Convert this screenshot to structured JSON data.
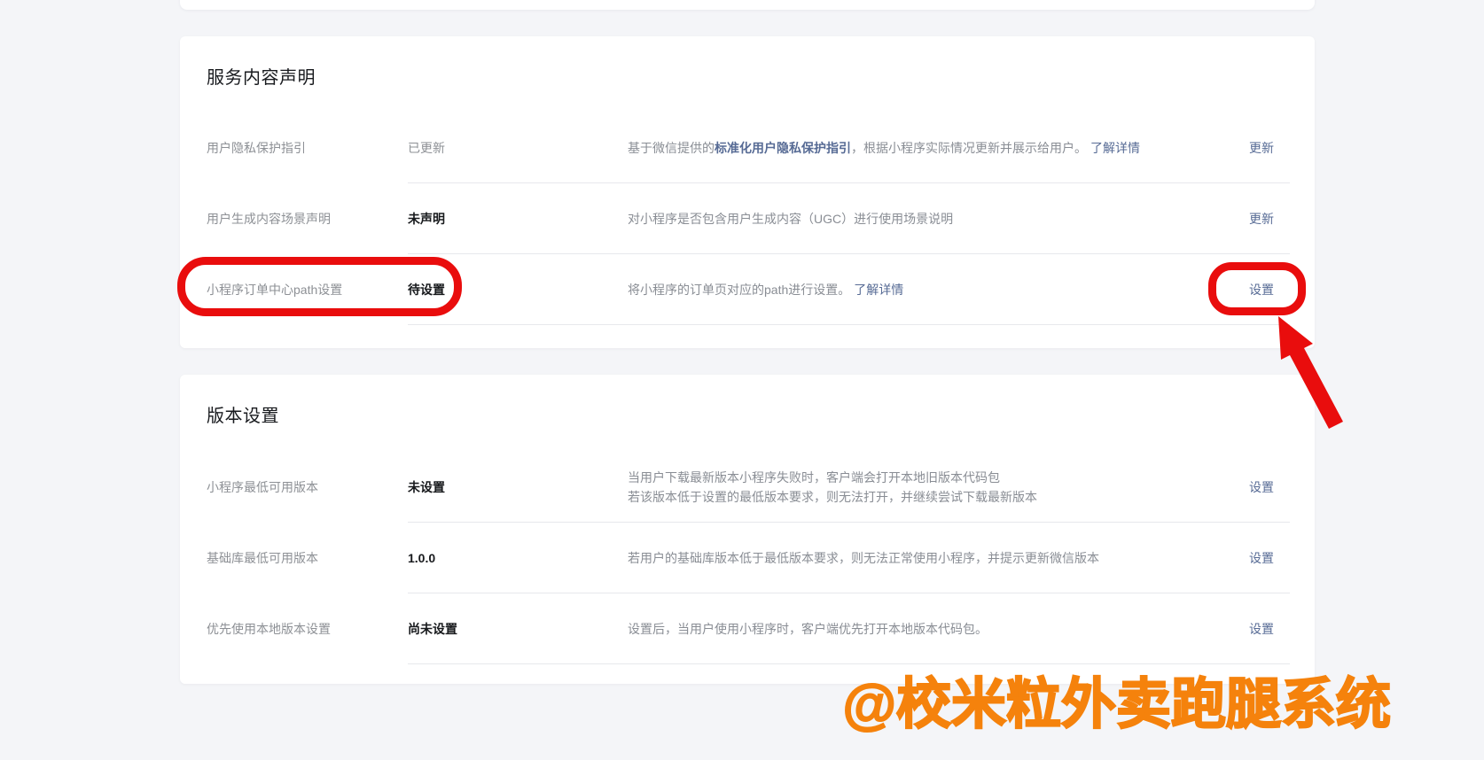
{
  "colors": {
    "page_bg": "#f4f5f8",
    "card_bg": "#ffffff",
    "link_blue": "#576b95",
    "annotation_red": "#e90d0d",
    "watermark_orange": "#f5820c",
    "text_strong": "#17191c",
    "text_muted": "#8d9095",
    "divider": "#e7e8ec"
  },
  "watermark": {
    "text": "@校米粒外卖跑腿系统"
  },
  "cards": [
    {
      "title": "服务内容声明",
      "rows": [
        {
          "label": "用户隐私保护指引",
          "status": "已更新",
          "desc_prefix": "基于微信提供的",
          "desc_link": "标准化用户隐私保护指引",
          "desc_suffix": "，根据小程序实际情况更新并展示给用户。",
          "desc_more": "了解详情",
          "action": "更新"
        },
        {
          "label": "用户生成内容场景声明",
          "status": "未声明",
          "desc": "对小程序是否包含用户生成内容（UGC）进行使用场景说明",
          "action": "更新"
        },
        {
          "label": "小程序订单中心path设置",
          "status": "待设置",
          "desc": "将小程序的订单页对应的path进行设置。",
          "desc_more": "了解详情",
          "action": "设置"
        }
      ]
    },
    {
      "title": "版本设置",
      "rows": [
        {
          "label": "小程序最低可用版本",
          "status": "未设置",
          "desc_lines": [
            "当用户下载最新版本小程序失败时，客户端会打开本地旧版本代码包",
            "若该版本低于设置的最低版本要求，则无法打开，并继续尝试下载最新版本"
          ],
          "action": "设置"
        },
        {
          "label": "基础库最低可用版本",
          "status": "1.0.0",
          "desc_lines": [
            "若用户的基础库版本低于最低版本要求，则无法正常使用小程序，并提示更新微信版本"
          ],
          "action": "设置"
        },
        {
          "label": "优先使用本地版本设置",
          "status": "尚未设置",
          "desc_lines": [
            "设置后，当用户使用小程序时，客户端优先打开本地版本代码包。"
          ],
          "action": "设置"
        }
      ]
    }
  ]
}
